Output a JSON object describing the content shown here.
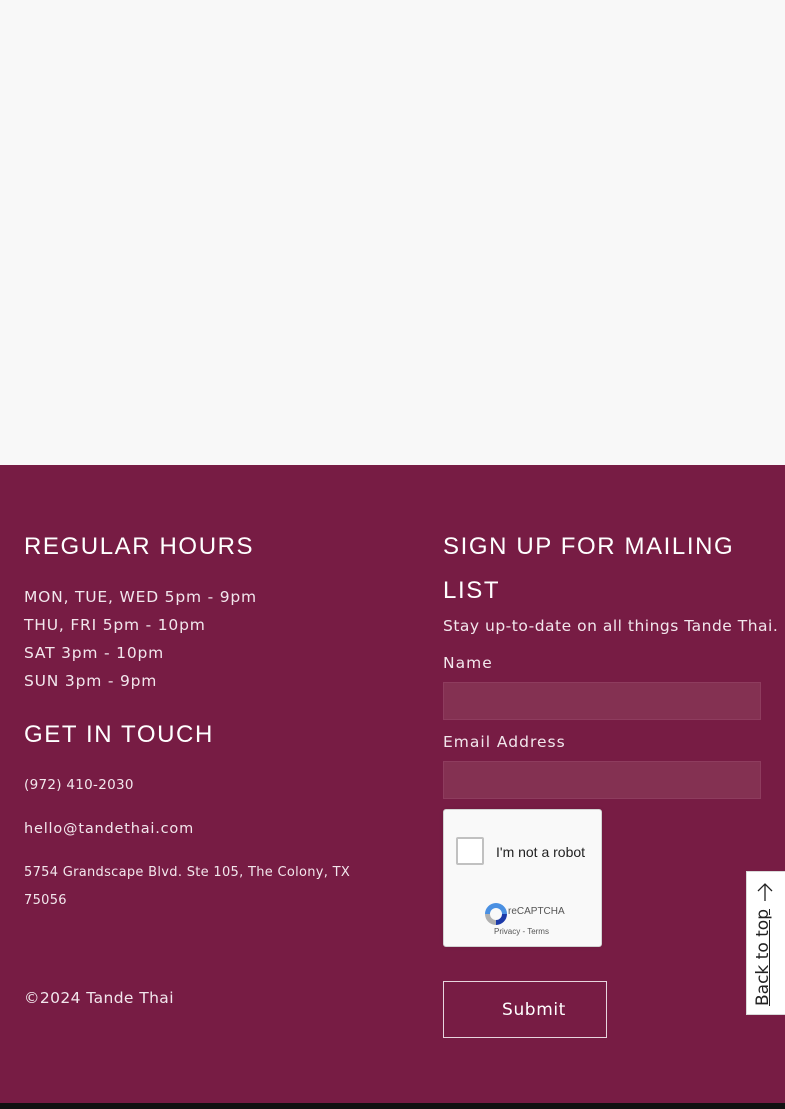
{
  "hours": {
    "heading": "REGULAR HOURS",
    "lines": [
      "MON, TUE, WED  5pm - 9pm",
      "THU, FRI  5pm - 10pm",
      "SAT  3pm - 10pm",
      "SUN  3pm - 9pm"
    ]
  },
  "contact": {
    "heading": "GET IN TOUCH",
    "phone": "(972) 410-2030",
    "email": "hello@tandethai.com",
    "address_line1": "5754 Grandscape Blvd. Ste 105, The Colony, TX",
    "address_line2": "75056"
  },
  "copyright": "©2024 Tande Thai",
  "mailing": {
    "heading_line1": "SIGN UP FOR MAILING",
    "heading_line2": "LIST",
    "subtitle": "Stay up-to-date on all things Tande Thai.",
    "name_label": "Name",
    "name_value": "",
    "email_label": "Email Address",
    "email_value": "",
    "captcha_text": "I'm not a robot",
    "captcha_brand": "reCAPTCHA",
    "captcha_links": "Privacy - Terms",
    "submit_label": "Submit"
  },
  "back_to_top": "Back to top",
  "colors": {
    "footer_bg": "#771c44",
    "field_bg": "#843152",
    "page_bg": "#f8f8f8"
  },
  "icons": [
    "arrow-up-icon",
    "recaptcha-logo-icon"
  ]
}
